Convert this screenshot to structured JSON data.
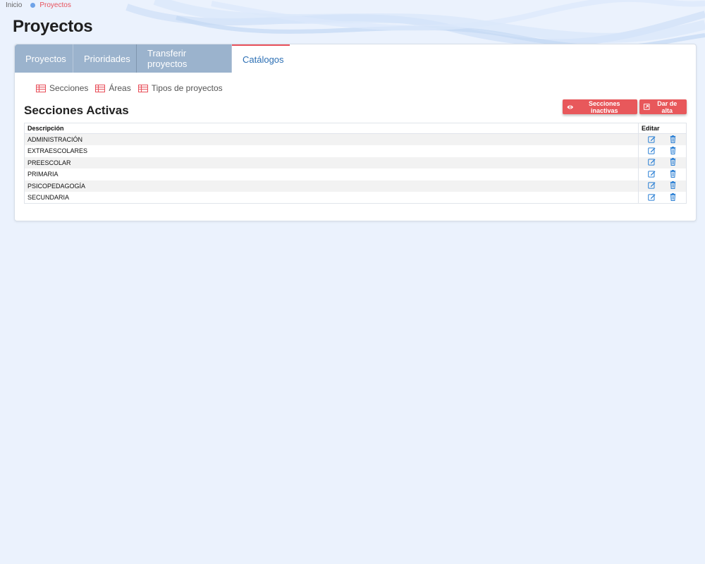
{
  "breadcrumb": {
    "home": "Inicio",
    "current": "Proyectos"
  },
  "page": {
    "title": "Proyectos"
  },
  "tabs": [
    {
      "label": "Proyectos",
      "active": false
    },
    {
      "label": "Prioridades",
      "active": false
    },
    {
      "label": "Transferir proyectos",
      "active": false
    },
    {
      "label": "Catálogos",
      "active": true
    }
  ],
  "subnav": [
    {
      "label": "Secciones",
      "icon": "table-icon"
    },
    {
      "label": "Áreas",
      "icon": "table-icon"
    },
    {
      "label": "Tipos de proyectos",
      "icon": "table-icon"
    }
  ],
  "section": {
    "title": "Secciones Activas"
  },
  "buttons": {
    "inactive_label": "Secciones inactivas",
    "add_label": "Dar de alta"
  },
  "table": {
    "headers": {
      "description": "Descripción",
      "edit": "Editar"
    },
    "rows": [
      {
        "description": "ADMINISTRACIÓN"
      },
      {
        "description": "EXTRAESCOLARES"
      },
      {
        "description": "PREESCOLAR"
      },
      {
        "description": "PRIMARIA"
      },
      {
        "description": "PSICOPEDAGOGÍA"
      },
      {
        "description": "SECUNDARIA"
      }
    ]
  },
  "colors": {
    "accent": "#e8505b",
    "tab_bg": "#9bb3cd",
    "link_blue": "#2c6fb4",
    "page_bg": "#ebf2fd"
  }
}
